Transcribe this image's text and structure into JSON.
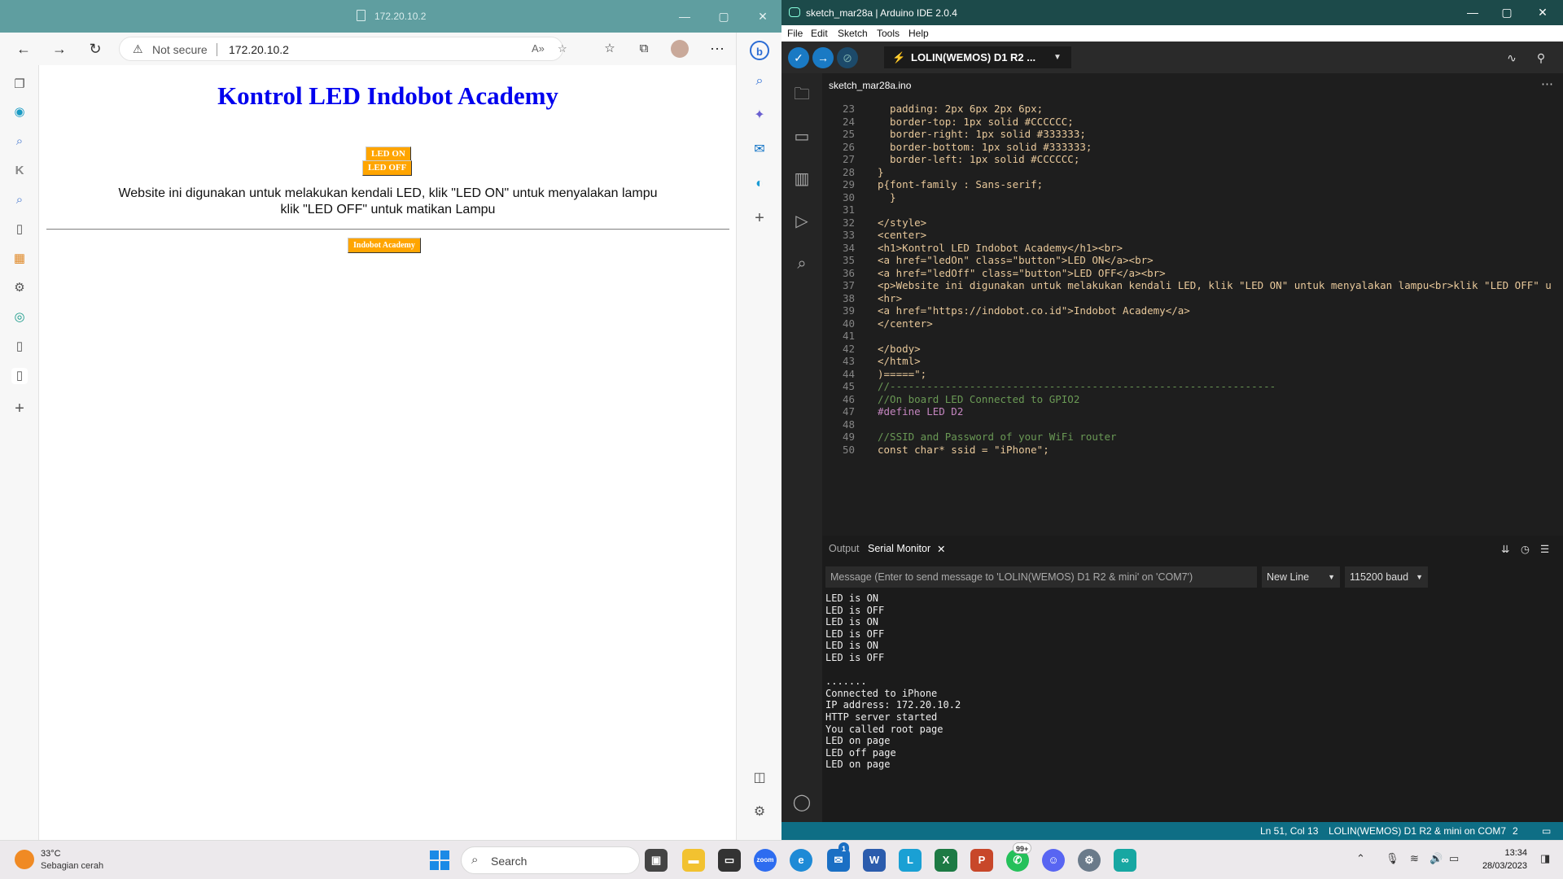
{
  "browser": {
    "title": "172.20.10.2",
    "address": {
      "security_label": "Not secure",
      "url": "172.20.10.2"
    },
    "page": {
      "heading": "Kontrol LED Indobot Academy",
      "led_on_label": "LED ON",
      "led_off_label": "LED OFF",
      "description_line1": "Website ini digunakan untuk melakukan kendali LED, klik \"LED ON\" untuk menyalakan lampu",
      "description_line2": "klik \"LED OFF\" untuk matikan Lampu",
      "footer_link": "Indobot Academy"
    }
  },
  "ide": {
    "title": "sketch_mar28a | Arduino IDE 2.0.4",
    "menu": [
      "File",
      "Edit",
      "Sketch",
      "Tools",
      "Help"
    ],
    "board": "LOLIN(WEMOS) D1 R2 ...",
    "tab": "sketch_mar28a.ino",
    "code": [
      {
        "n": "23",
        "t": "  padding: 2px 6px 2px 6px;"
      },
      {
        "n": "24",
        "t": "  border-top: 1px solid #CCCCCC;"
      },
      {
        "n": "25",
        "t": "  border-right: 1px solid #333333;"
      },
      {
        "n": "26",
        "t": "  border-bottom: 1px solid #333333;"
      },
      {
        "n": "27",
        "t": "  border-left: 1px solid #CCCCCC;"
      },
      {
        "n": "28",
        "t": "}"
      },
      {
        "n": "29",
        "t": "p{font-family : Sans-serif;"
      },
      {
        "n": "30",
        "t": "  }"
      },
      {
        "n": "31",
        "t": ""
      },
      {
        "n": "32",
        "t": "</style>"
      },
      {
        "n": "33",
        "t": "<center>"
      },
      {
        "n": "34",
        "t": "<h1>Kontrol LED Indobot Academy</h1><br>"
      },
      {
        "n": "35",
        "t": "<a href=\"ledOn\" class=\"button\">LED ON</a><br>"
      },
      {
        "n": "36",
        "t": "<a href=\"ledOff\" class=\"button\">LED OFF</a><br>"
      },
      {
        "n": "37",
        "t": "<p>Website ini digunakan untuk melakukan kendali LED, klik \"LED ON\" untuk menyalakan lampu<br>klik \"LED OFF\" u"
      },
      {
        "n": "38",
        "t": "<hr>"
      },
      {
        "n": "39",
        "t": "<a href=\"https://indobot.co.id\">Indobot Academy</a>"
      },
      {
        "n": "40",
        "t": "</center>"
      },
      {
        "n": "41",
        "t": ""
      },
      {
        "n": "42",
        "t": "</body>"
      },
      {
        "n": "43",
        "t": "</html>"
      },
      {
        "n": "44",
        "t": ")=====\";"
      },
      {
        "n": "45",
        "t": "//---------------------------------------------------------------"
      },
      {
        "n": "46",
        "t": "//On board LED Connected to GPIO2"
      },
      {
        "n": "47",
        "t": "#define LED D2"
      },
      {
        "n": "48",
        "t": ""
      },
      {
        "n": "49",
        "t": "//SSID and Password of your WiFi router"
      },
      {
        "n": "50",
        "t": "const char* ssid = \"iPhone\";"
      }
    ],
    "panel": {
      "output_tab": "Output",
      "serial_tab": "Serial Monitor",
      "message_placeholder": "Message (Enter to send message to 'LOLIN(WEMOS) D1 R2 & mini' on 'COM7')",
      "line_ending": "New Line",
      "baud": "115200 baud",
      "serial_lines": [
        "LED is ON",
        "LED is OFF",
        "LED is ON",
        "LED is OFF",
        "LED is ON",
        "LED is OFF",
        "",
        ".......",
        "Connected to iPhone",
        "IP address: 172.20.10.2",
        "HTTP server started",
        "You called root page",
        "LED on page",
        "LED off page",
        "LED on page"
      ]
    },
    "status": {
      "position": "Ln 51, Col 13",
      "board_port": "LOLIN(WEMOS) D1 R2 & mini on COM7",
      "notifications": "2"
    }
  },
  "taskbar": {
    "temperature": "33°C",
    "weather": "Sebagian cerah",
    "search_label": "Search",
    "whatsapp_badge": "99+",
    "mail_badge": "1",
    "time": "13:34",
    "date": "28/03/2023"
  }
}
